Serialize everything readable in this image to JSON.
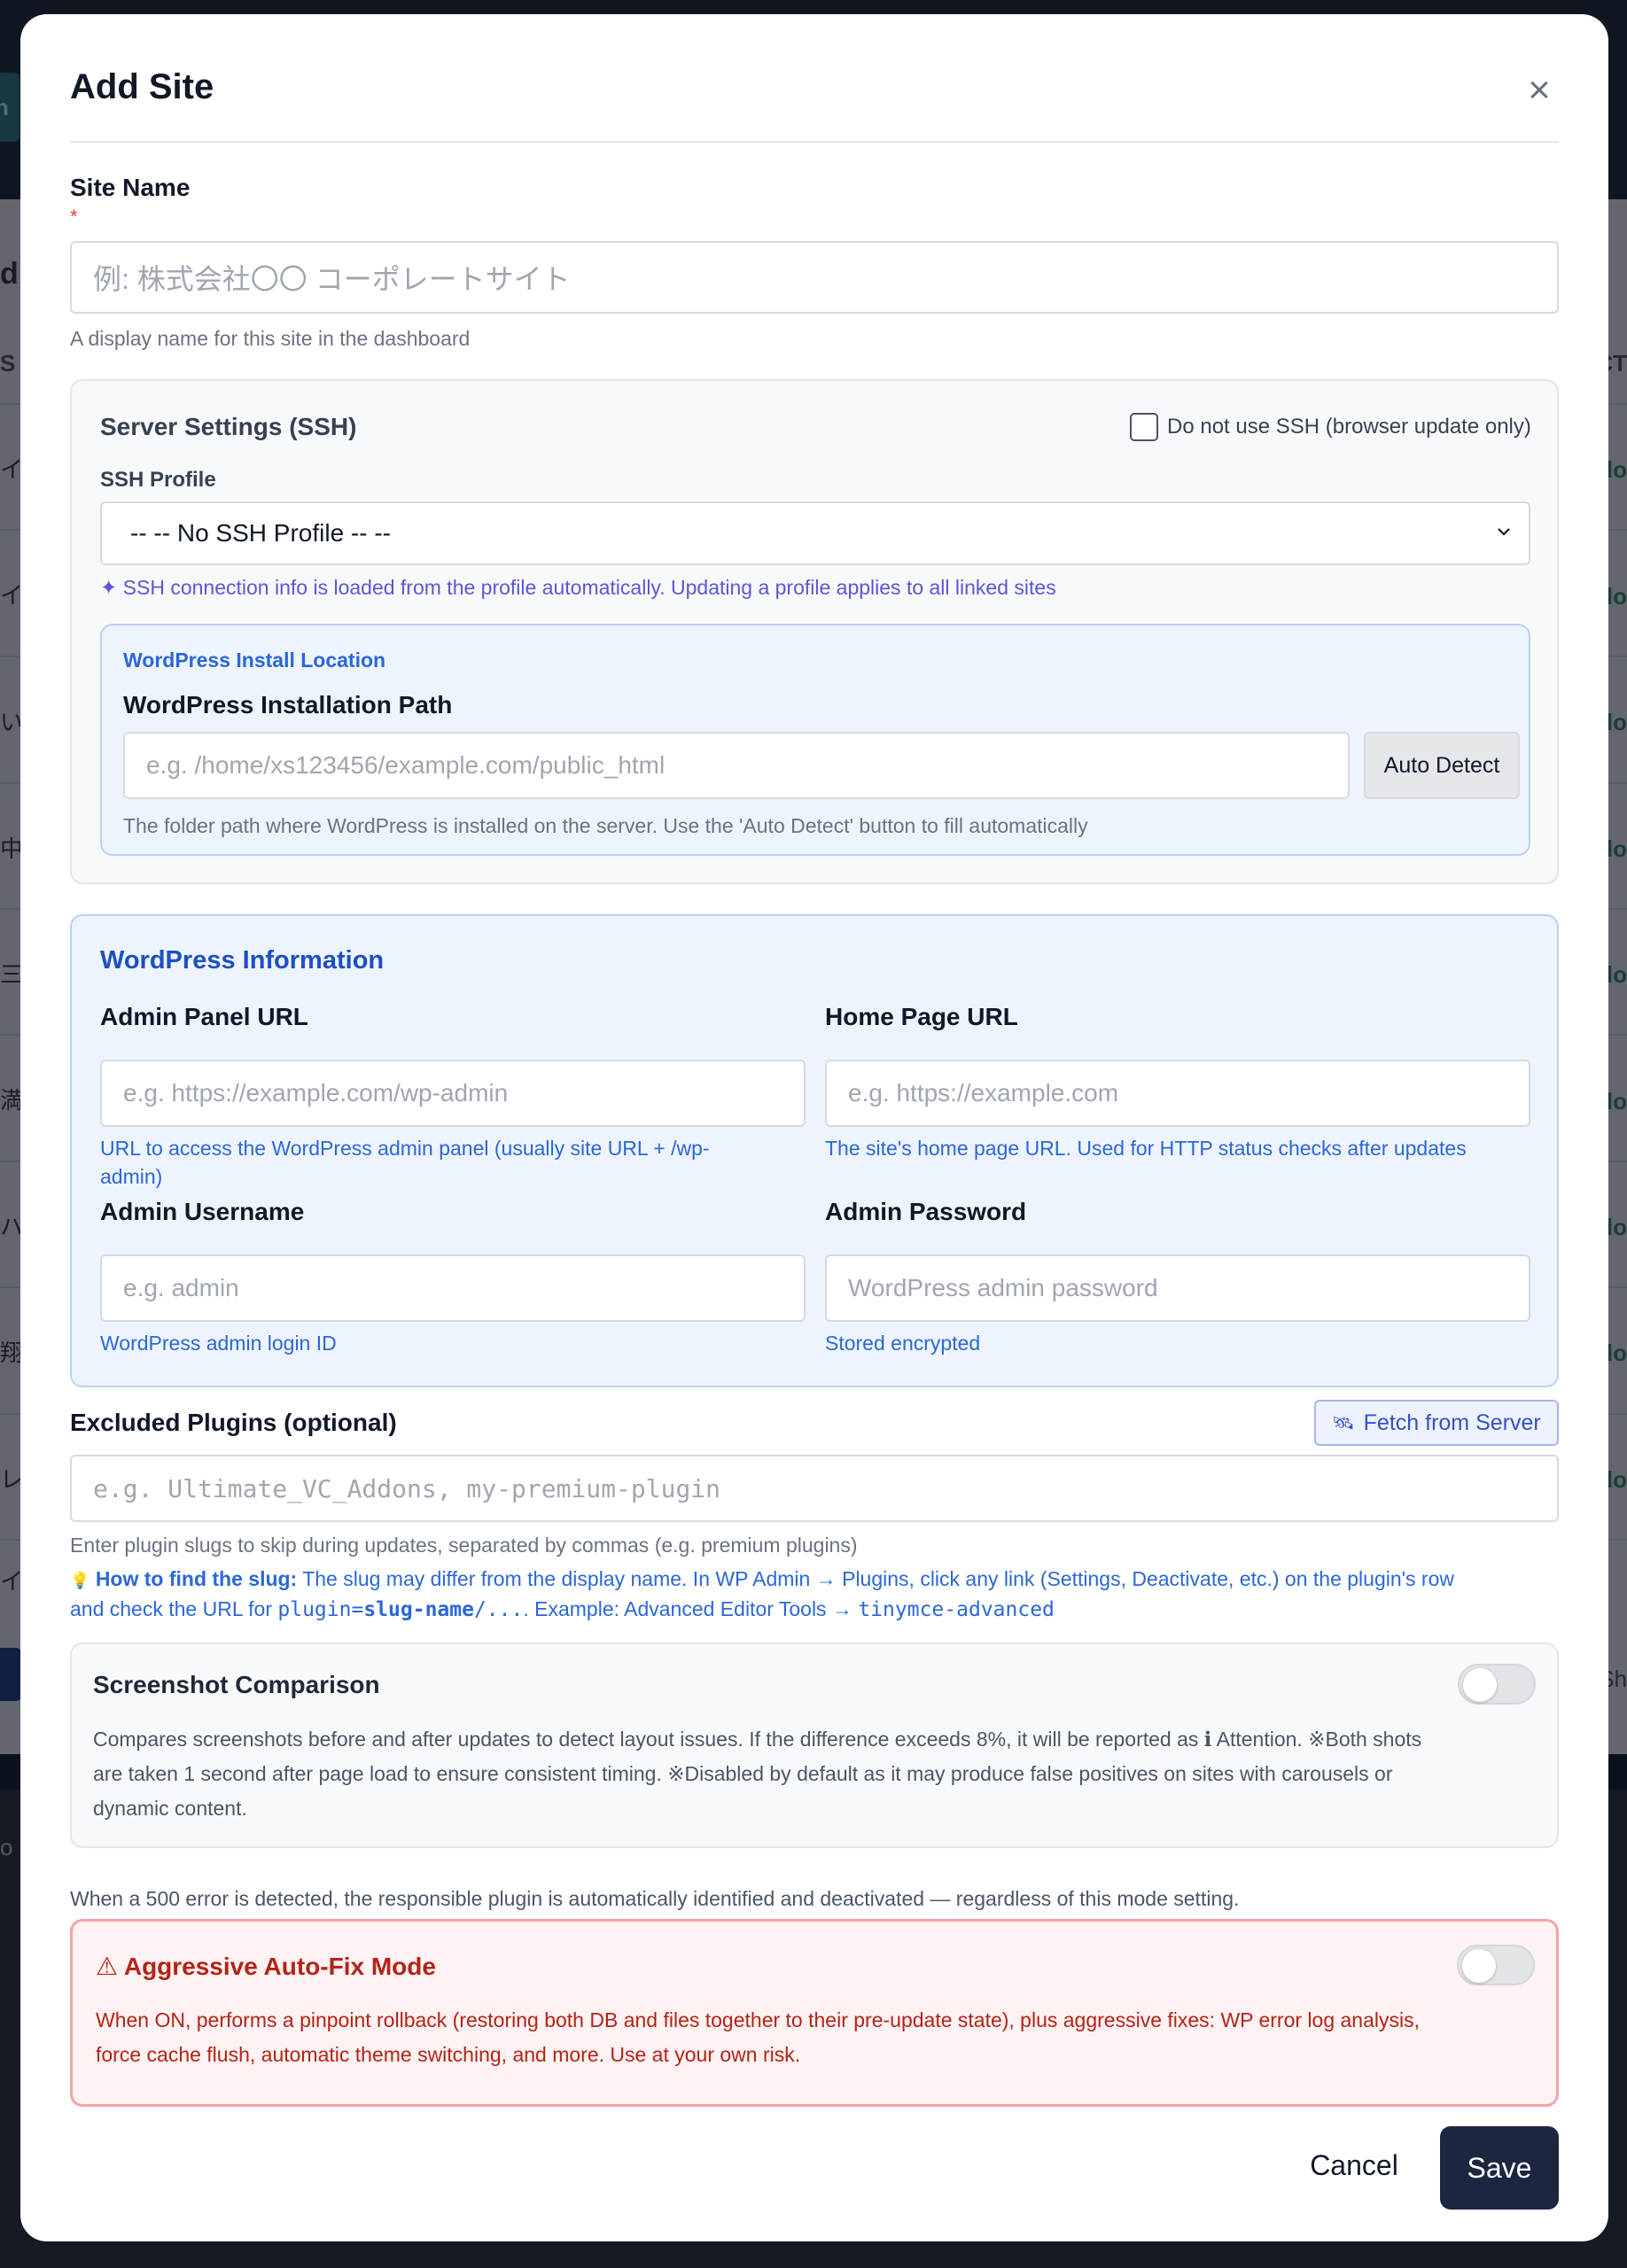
{
  "background": {
    "tab_fragment": "n",
    "left_fragments": [
      "d",
      "S",
      "イ",
      "イ",
      "い",
      "中",
      "三",
      "満",
      "ハ",
      "翔",
      "レ",
      "イ",
      "o"
    ],
    "right_fragments": [
      "CT",
      "lo",
      "lo",
      "lo",
      "lo",
      "lo",
      "lo",
      "lo",
      "lo",
      "lo",
      "Sh"
    ]
  },
  "modal": {
    "title": "Add Site",
    "close_icon": "close-icon"
  },
  "site_name": {
    "label": "Site Name",
    "required_mark": "*",
    "placeholder": "例: 株式会社〇〇 コーポレートサイト",
    "help": "A display name for this site in the dashboard"
  },
  "ssh": {
    "title": "Server Settings (SSH)",
    "no_ssh_label": "Do not use SSH (browser update only)",
    "profile_label": "SSH Profile",
    "profile_value": "-- -- No SSH Profile -- --",
    "info": "✦ SSH connection info is loaded from the profile automatically. Updating a profile applies to all linked sites",
    "wp_location": {
      "section_title": "WordPress Install Location",
      "path_label": "WordPress Installation Path",
      "path_placeholder": "e.g. /home/xs123456/example.com/public_html",
      "auto_detect": "Auto Detect",
      "help": "The folder path where WordPress is installed on the server. Use the 'Auto Detect' button to fill automatically"
    }
  },
  "wp_info": {
    "title": "WordPress Information",
    "admin_url": {
      "label": "Admin Panel URL",
      "placeholder": "e.g. https://example.com/wp-admin",
      "help_line1": "URL to access the WordPress admin panel (usually site URL + /wp-",
      "help_line2": "admin)"
    },
    "home_url": {
      "label": "Home Page URL",
      "placeholder": "e.g. https://example.com",
      "help": "The site's home page URL. Used for HTTP status checks after updates"
    },
    "admin_user": {
      "label": "Admin Username",
      "placeholder": "e.g. admin",
      "help": "WordPress admin login ID"
    },
    "admin_pass": {
      "label": "Admin Password",
      "placeholder": "WordPress admin password",
      "help": "Stored encrypted"
    }
  },
  "excluded": {
    "label": "Excluded Plugins (optional)",
    "fetch_button": "Fetch from Server",
    "fetch_icon": "🛰",
    "placeholder": "e.g. Ultimate_VC_Addons, my-premium-plugin",
    "help": "Enter plugin slugs to skip during updates, separated by commas (e.g. premium plugins)",
    "tip_icon": "💡",
    "tip_bold": "How to find the slug:",
    "tip_text1": " The slug may differ from the display name. In WP Admin → Plugins, click any link (Settings, Deactivate, etc.) on the plugin's row",
    "tip_text2a": "and check the URL for ",
    "tip_code1a": "plugin=",
    "tip_code1b": "slug-name",
    "tip_code1c": "/...",
    "tip_text2b": ". Example: Advanced Editor Tools → ",
    "tip_code2": "tinymce-advanced"
  },
  "screenshot": {
    "title": "Screenshot Comparison",
    "line1": "Compares screenshots before and after updates to detect layout issues. If the difference exceeds 8%, it will be reported as ℹ Attention. ※Both shots",
    "line2": "are taken 1 second after page load to ensure consistent timing. ※Disabled by default as it may produce false positives on sites with carousels or",
    "line3": "dynamic content.",
    "enabled": false
  },
  "note_500": "When a 500 error is detected, the responsible plugin is automatically identified and deactivated — regardless of this mode setting.",
  "aggressive": {
    "title": "⚠ Aggressive Auto-Fix Mode",
    "line1": "When ON, performs a pinpoint rollback (restoring both DB and files together to their pre-update state), plus aggressive fixes: WP error log analysis,",
    "line2": "force cache flush, automatic theme switching, and more. Use at your own risk.",
    "enabled": false
  },
  "footer": {
    "cancel": "Cancel",
    "save": "Save"
  },
  "colors": {
    "accent_blue": "#2b67d6",
    "primary_dark": "#1b2740",
    "danger_red": "#b42318"
  }
}
